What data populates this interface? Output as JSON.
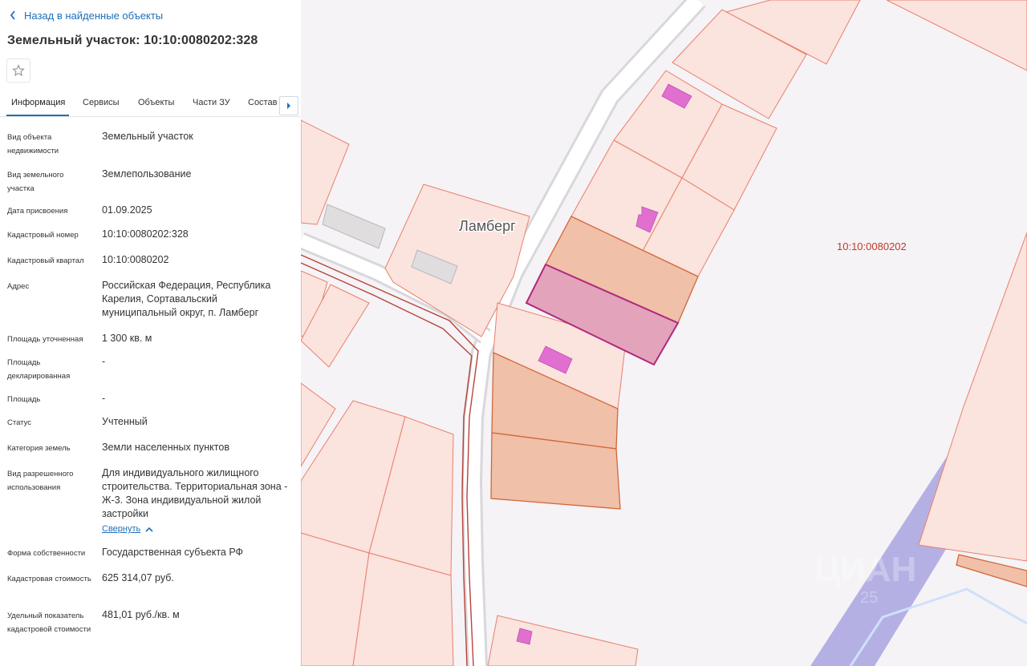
{
  "header": {
    "back_label": "Назад в найденные объекты",
    "title": "Земельный участок: 10:10:0080202:328"
  },
  "tabs": [
    "Информация",
    "Сервисы",
    "Объекты",
    "Части ЗУ",
    "Состав"
  ],
  "active_tab": "Информация",
  "fields": {
    "object_type": {
      "label": "Вид объекта недвижимости",
      "value": "Земельный участок"
    },
    "land_type": {
      "label": "Вид земельного участка",
      "value": "Землепользование"
    },
    "assign_date": {
      "label": "Дата присвоения",
      "value": "01.09.2025"
    },
    "cadastral_number": {
      "label": "Кадастровый номер",
      "value": "10:10:0080202:328"
    },
    "cadastral_quarter": {
      "label": "Кадастровый квартал",
      "value": "10:10:0080202"
    },
    "address": {
      "label": "Адрес",
      "value": "Российская Федерация, Республика Карелия, Сортавальский муниципальный округ, п. Ламберг"
    },
    "area_specified": {
      "label": "Площадь уточненная",
      "value": "1 300 кв. м"
    },
    "area_declared": {
      "label": "Площадь декларированная",
      "value": "-"
    },
    "area": {
      "label": "Площадь",
      "value": "-"
    },
    "status": {
      "label": "Статус",
      "value": "Учтенный"
    },
    "land_category": {
      "label": "Категория земель",
      "value": "Земли населенных пунктов"
    },
    "permitted_use": {
      "label": "Вид разрешенного использования",
      "value": "Для индивидуального жилищного строительства. Территориальная зона - Ж-3. Зона индивидуальной жилой застройки"
    },
    "ownership": {
      "label": "Форма собственности",
      "value": "Государственная субъекта РФ"
    },
    "cadastral_value": {
      "label": "Кадастровая стоимость",
      "value": "625 314,07 руб."
    },
    "specific_value": {
      "label": "Удельный показатель кадастровой стоимости",
      "value": "481,01 руб./кв. м"
    }
  },
  "collapse_label": "Свернуть",
  "map": {
    "settlement_label": "Ламберг",
    "quarter_label": "10:10:0080202",
    "watermark": "ЦИАН",
    "watermark_sub": "25"
  },
  "icons": {
    "back": "chevron-left-icon",
    "favorite": "star-icon",
    "tabs_next": "caret-right-icon",
    "collapse": "chevron-up-icon"
  },
  "colors": {
    "link": "#1e6fb8",
    "parcel_fill": "#fbe3de",
    "parcel_stroke": "#e8806a",
    "selected_fill": "#e3a3bb",
    "selected_stroke": "#b0287d",
    "building": "#e06fd0",
    "quarter_text": "#c0392b"
  }
}
